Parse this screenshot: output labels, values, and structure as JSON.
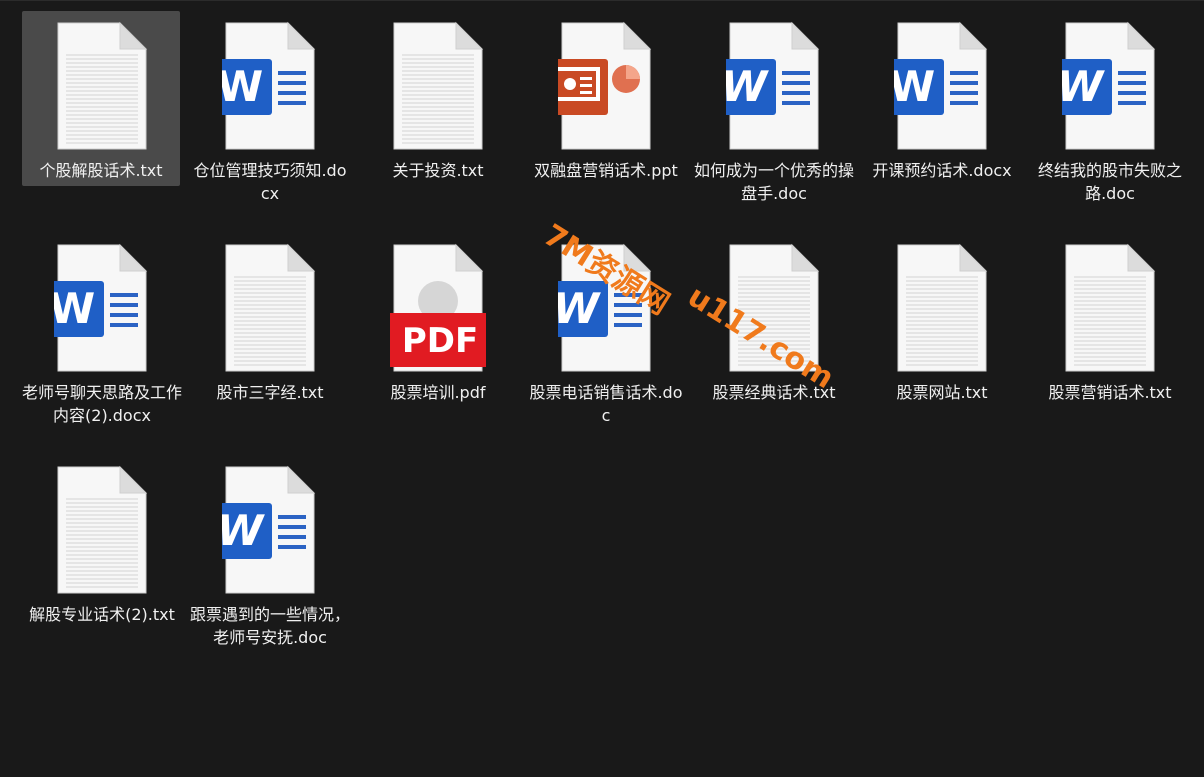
{
  "files": [
    {
      "name": "个股解股话术.txt",
      "type": "txt",
      "selected": true
    },
    {
      "name": "仓位管理技巧须知.docx",
      "type": "docx"
    },
    {
      "name": "关于投资.txt",
      "type": "txt"
    },
    {
      "name": "双融盘营销话术.ppt",
      "type": "ppt"
    },
    {
      "name": "如何成为一个优秀的操盘手.doc",
      "type": "doc"
    },
    {
      "name": "开课预约话术.docx",
      "type": "docx"
    },
    {
      "name": "终结我的股市失败之路.doc",
      "type": "doc"
    },
    {
      "name": "老师号聊天思路及工作内容(2).docx",
      "type": "docx"
    },
    {
      "name": "股市三字经.txt",
      "type": "txt"
    },
    {
      "name": "股票培训.pdf",
      "type": "pdf"
    },
    {
      "name": "股票电话销售话术.doc",
      "type": "doc"
    },
    {
      "name": "股票经典话术.txt",
      "type": "txt"
    },
    {
      "name": "股票网站.txt",
      "type": "txt"
    },
    {
      "name": "股票营销话术.txt",
      "type": "txt"
    },
    {
      "name": "解股专业话术(2).txt",
      "type": "txt"
    },
    {
      "name": "跟票遇到的一些情况，老师号安抚.doc",
      "type": "doc"
    }
  ],
  "icon_badges": {
    "word": "W",
    "pdf": "PDF"
  },
  "watermark": {
    "line1": "7M资源网",
    "line2": "u117.com"
  },
  "colors": {
    "background": "#191919",
    "word_blue": "#1f5fc6",
    "ppt_orange": "#c94a24",
    "pdf_red": "#e11b22",
    "watermark": "#f07a1c"
  }
}
